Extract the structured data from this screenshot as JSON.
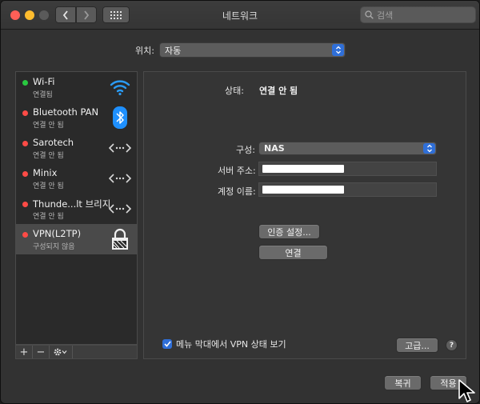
{
  "window": {
    "title": "네트워크"
  },
  "search": {
    "placeholder": "검색"
  },
  "location": {
    "label": "위치:",
    "value": "자동"
  },
  "services": [
    {
      "name": "Wi-Fi",
      "status": "연결됨",
      "status_color": "#29c940",
      "icon": "wifi-icon"
    },
    {
      "name": "Bluetooth PAN",
      "status": "연결 안 됨",
      "status_color": "#ff4b46",
      "icon": "bluetooth-icon"
    },
    {
      "name": "Sarotech",
      "status": "연결 안 됨",
      "status_color": "#ff4b46",
      "icon": "ethernet-arrows-icon"
    },
    {
      "name": "Minix",
      "status": "연결 안 됨",
      "status_color": "#ff4b46",
      "icon": "ethernet-arrows-icon"
    },
    {
      "name": "Thunde...lt 브리지",
      "status": "연결 안 됨",
      "status_color": "#ff4b46",
      "icon": "ethernet-arrows-icon"
    },
    {
      "name": "VPN(L2TP)",
      "status": "구성되지 않음",
      "status_color": "#ff4b46",
      "icon": "vpn-lock-icon",
      "selected": true
    }
  ],
  "sidebar_toolbar": {
    "add": "+",
    "remove": "−"
  },
  "detail": {
    "status_label": "상태:",
    "status_value": "연결 안 됨",
    "config_label": "구성:",
    "config_value": "NAS",
    "server_label": "서버 주소:",
    "account_label": "계정 이름:",
    "auth_button": "인증 설정...",
    "connect_button": "연결",
    "show_vpn_checkbox": "메뉴 막대에서 VPN 상태 보기",
    "show_vpn_checked": true,
    "advanced_button": "고급...",
    "help": "?"
  },
  "footer": {
    "revert": "복귀",
    "apply": "적용"
  },
  "colors": {
    "accent": "#2f6fd8",
    "wifi": "#2b9bf4",
    "bluetooth": "#1e90ff"
  }
}
